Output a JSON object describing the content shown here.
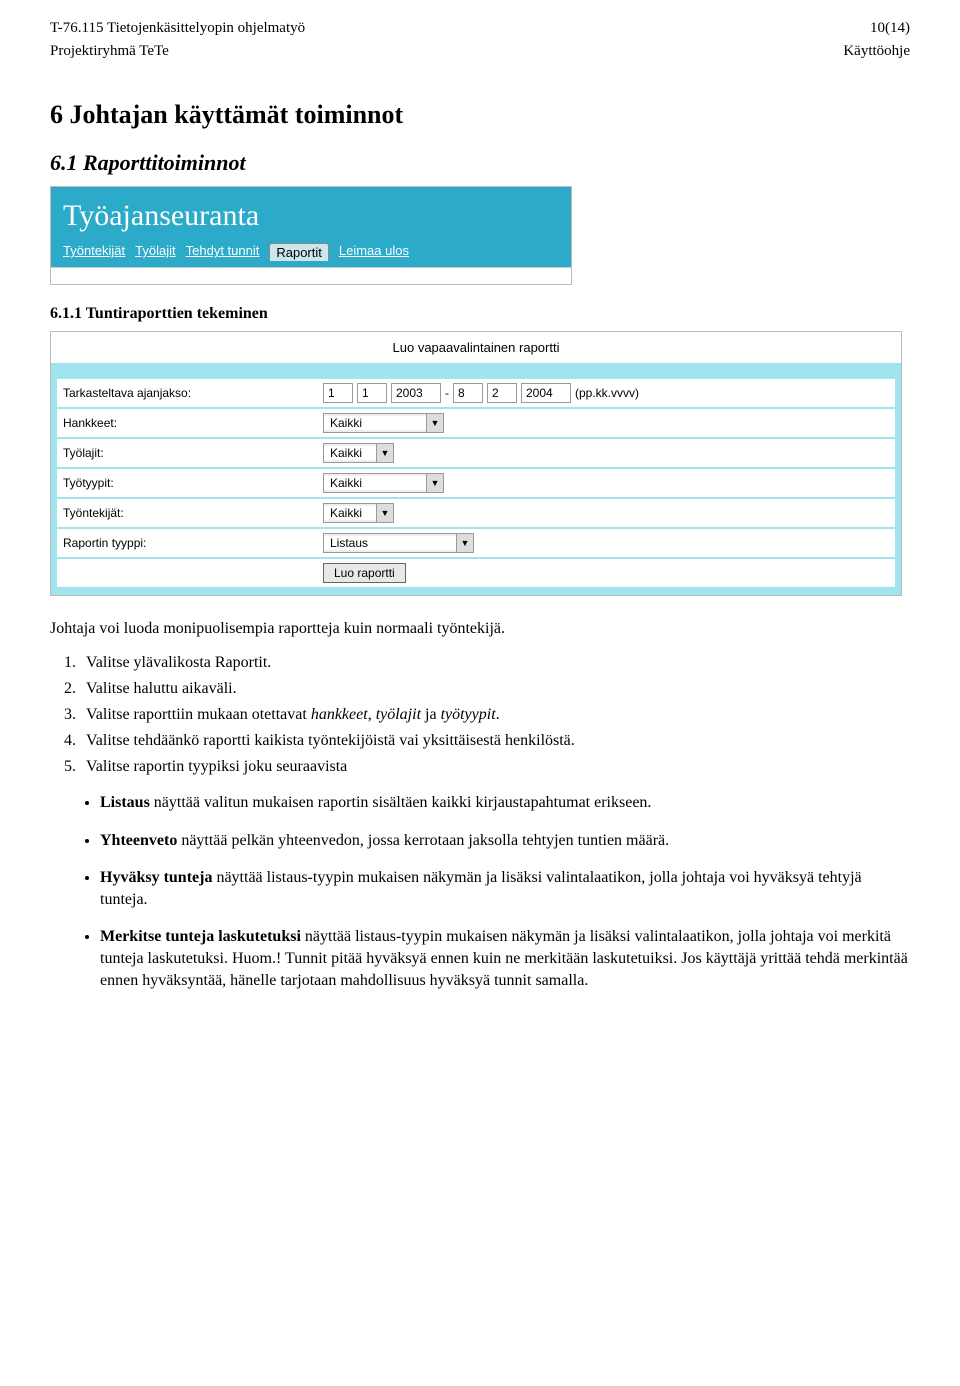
{
  "header": {
    "title": "T-76.115 Tietojenkäsittelyopin ohjelmatyö",
    "page": "10(14)",
    "team": "Projektiryhmä TeTe",
    "doctype": "Käyttöohje"
  },
  "section": {
    "title": "6  Johtajan käyttämät toiminnot",
    "subsection": "6.1 Raporttitoiminnot",
    "subsubsection": "6.1.1 Tuntiraporttien tekeminen"
  },
  "app": {
    "title": "Työajanseuranta",
    "tabs": [
      "Työntekijät",
      "Työlajit",
      "Tehdyt tunnit",
      "Raportit",
      "Leimaa ulos"
    ],
    "active_tab": "Raportit"
  },
  "form": {
    "title": "Luo vapaavalintainen raportti",
    "rows": {
      "period_label": "Tarkasteltava ajanjakso:",
      "period_from": {
        "d": "1",
        "m": "1",
        "y": "2003"
      },
      "period_sep": "-",
      "period_to": {
        "d": "8",
        "m": "2",
        "y": "2004"
      },
      "period_hint": "(pp.kk.vvvv)",
      "hankkeet_label": "Hankkeet:",
      "hankkeet_value": "Kaikki",
      "tyolajit_label": "Työlajit:",
      "tyolajit_value": "Kaikki",
      "tyotyypit_label": "Työtyypit:",
      "tyotyypit_value": "Kaikki",
      "tyontekijat_label": "Työntekijät:",
      "tyontekijat_value": "Kaikki",
      "raportin_tyyppi_label": "Raportin tyyppi:",
      "raportin_tyyppi_value": "Listaus",
      "button": "Luo raportti"
    }
  },
  "body": {
    "intro": "Johtaja voi luoda monipuolisempia raportteja kuin normaali työntekijä.",
    "steps": [
      "Valitse ylävalikosta Raportit.",
      "Valitse haluttu aikaväli.",
      "Valitse raporttiin mukaan otettavat hankkeet, työlajit ja työtyypit.",
      "Valitse tehdäänkö raportti kaikista työntekijöistä vai yksittäisestä henkilöstä.",
      "Valitse raportin tyypiksi joku seuraavista"
    ],
    "bullets": [
      {
        "lead": "Listaus",
        "tail": " näyttää valitun mukaisen raportin sisältäen kaikki kirjaustapahtumat erikseen."
      },
      {
        "lead": "Yhteenveto",
        "tail": " näyttää pelkän yhteenvedon, jossa kerrotaan jaksolla tehtyjen tuntien määrä."
      },
      {
        "lead": "Hyväksy tunteja",
        "tail": " näyttää listaus-tyypin mukaisen näkymän ja lisäksi valintalaatikon, jolla johtaja voi  hyväksyä tehtyjä tunteja."
      },
      {
        "lead": "Merkitse tunteja laskutetuksi",
        "tail": " näyttää listaus-tyypin mukaisen näkymän ja lisäksi valintalaatikon, jolla johtaja voi merkitä tunteja laskutetuksi. Huom.! Tunnit pitää hyväksyä ennen kuin ne merkitään laskutetuiksi. Jos käyttäjä yrittää tehdä merkintää ennen hyväksyntää, hänelle tarjotaan mahdollisuus hyväksyä tunnit samalla."
      }
    ]
  }
}
